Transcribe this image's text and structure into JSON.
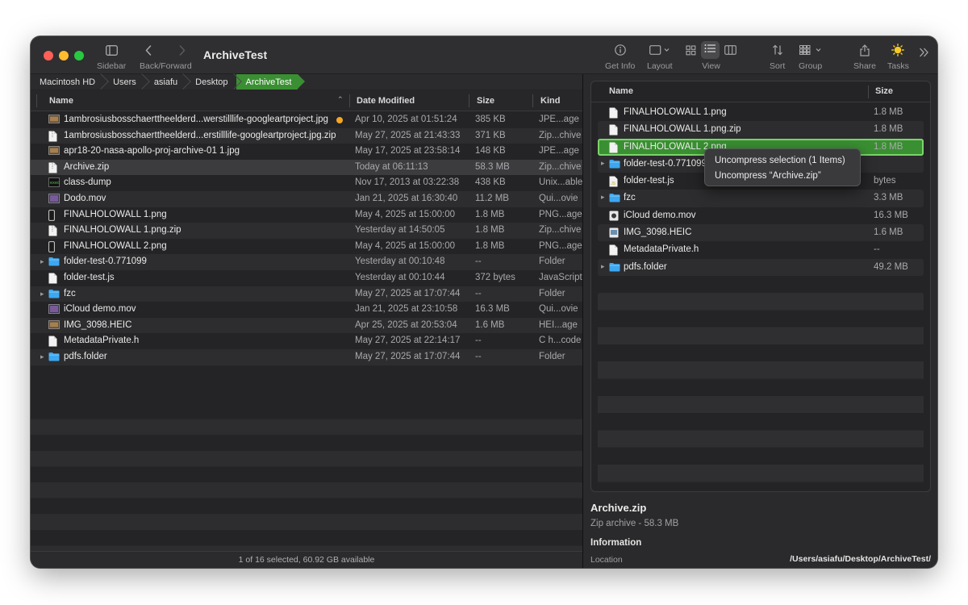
{
  "window": {
    "title": "ArchiveTest"
  },
  "toolbar": {
    "sidebar_label": "Sidebar",
    "backforward_label": "Back/Forward",
    "getinfo_label": "Get Info",
    "layout_label": "Layout",
    "view_label": "View",
    "sort_label": "Sort",
    "group_label": "Group",
    "share_label": "Share",
    "tasks_label": "Tasks"
  },
  "path": [
    "Macintosh HD",
    "Users",
    "asiafu",
    "Desktop",
    "ArchiveTest"
  ],
  "left_columns": {
    "name": "Name",
    "date": "Date Modified",
    "size": "Size",
    "kind": "Kind"
  },
  "files": [
    {
      "name": "1ambrosiusbosschaerttheelderd...werstilllife-googleartproject.jpg",
      "date": "Apr 10, 2025 at 01:51:24",
      "size": "385 KB",
      "kind": "JPE...age",
      "icon": "image-thumb-icon",
      "tag": "#f5a623"
    },
    {
      "name": "1ambrosiusbosschaerttheelderd...erstilllife-googleartproject.jpg.zip",
      "date": "May 27, 2025 at 21:43:33",
      "size": "371 KB",
      "kind": "Zip...chive",
      "icon": "zip-file-icon"
    },
    {
      "name": "apr18-20-nasa-apollo-proj-archive-01 1.jpg",
      "date": "May 17, 2025 at 23:58:14",
      "size": "148 KB",
      "kind": "JPE...age",
      "icon": "image-thumb-icon"
    },
    {
      "name": "Archive.zip",
      "date": "Today at 06:11:13",
      "size": "58.3 MB",
      "kind": "Zip...chive",
      "icon": "zip-file-icon",
      "selected": true
    },
    {
      "name": "class-dump",
      "date": "Nov 17, 2013 at 03:22:38",
      "size": "438 KB",
      "kind": "Unix...able",
      "icon": "terminal-exec-icon"
    },
    {
      "name": "Dodo.mov",
      "date": "Jan 21, 2025 at 16:30:40",
      "size": "11.2 MB",
      "kind": "Qui...ovie",
      "icon": "movie-thumb-icon"
    },
    {
      "name": "FINALHOLOWALL 1.png",
      "date": "May 4, 2025 at 15:00:00",
      "size": "1.8 MB",
      "kind": "PNG...age",
      "icon": "phone-thumb-icon"
    },
    {
      "name": "FINALHOLOWALL 1.png.zip",
      "date": "Yesterday at 14:50:05",
      "size": "1.8 MB",
      "kind": "Zip...chive",
      "icon": "zip-file-icon"
    },
    {
      "name": "FINALHOLOWALL 2.png",
      "date": "May 4, 2025 at 15:00:00",
      "size": "1.8 MB",
      "kind": "PNG...age",
      "icon": "phone-thumb-icon"
    },
    {
      "name": "folder-test-0.771099",
      "date": "Yesterday at 00:10:48",
      "size": "--",
      "kind": "Folder",
      "icon": "folder-icon",
      "expandable": true
    },
    {
      "name": "folder-test.js",
      "date": "Yesterday at 00:10:44",
      "size": "372 bytes",
      "kind": "JavaScript",
      "icon": "document-icon"
    },
    {
      "name": "fzc",
      "date": "May 27, 2025 at 17:07:44",
      "size": "--",
      "kind": "Folder",
      "icon": "folder-icon",
      "expandable": true
    },
    {
      "name": "iCloud demo.mov",
      "date": "Jan 21, 2025 at 23:10:58",
      "size": "16.3 MB",
      "kind": "Qui...ovie",
      "icon": "movie-thumb-icon"
    },
    {
      "name": "IMG_3098.HEIC",
      "date": "Apr 25, 2025 at 20:53:04",
      "size": "1.6 MB",
      "kind": "HEI...age",
      "icon": "image-thumb-icon"
    },
    {
      "name": "MetadataPrivate.h",
      "date": "May 27, 2025 at 22:14:17",
      "size": "--",
      "kind": "C h...code",
      "icon": "document-icon"
    },
    {
      "name": "pdfs.folder",
      "date": "May 27, 2025 at 17:07:44",
      "size": "--",
      "kind": "Folder",
      "icon": "folder-icon",
      "expandable": true
    }
  ],
  "status": "1 of 16 selected, 60.92 GB available",
  "right_columns": {
    "name": "Name",
    "size": "Size"
  },
  "archive_contents": [
    {
      "name": "FINALHOLOWALL 1.png",
      "size": "1.8 MB",
      "icon": "document-icon"
    },
    {
      "name": "FINALHOLOWALL 1.png.zip",
      "size": "1.8 MB",
      "icon": "document-icon"
    },
    {
      "name": "FINALHOLOWALL 2.png",
      "size": "1.8 MB",
      "icon": "document-icon",
      "selected": true
    },
    {
      "name": "folder-test-0.771099",
      "size": "",
      "icon": "folder-icon",
      "expandable": true
    },
    {
      "name": "folder-test.js",
      "size": "bytes",
      "icon": "js-file-icon"
    },
    {
      "name": "fzc",
      "size": "3.3 MB",
      "icon": "folder-icon",
      "expandable": true
    },
    {
      "name": "iCloud demo.mov",
      "size": "16.3 MB",
      "icon": "movie-file-icon"
    },
    {
      "name": "IMG_3098.HEIC",
      "size": "1.6 MB",
      "icon": "image-file-icon"
    },
    {
      "name": "MetadataPrivate.h",
      "size": "--",
      "icon": "document-icon"
    },
    {
      "name": "pdfs.folder",
      "size": "49.2 MB",
      "icon": "folder-icon",
      "expandable": true
    }
  ],
  "context_menu": {
    "items": [
      "Uncompress selection (1 Items)",
      "Uncompress “Archive.zip”"
    ]
  },
  "info": {
    "name": "Archive.zip",
    "kind": "Zip archive - 58.3 MB",
    "section": "Information",
    "location_label": "Location",
    "location_value": "/Users/asiafu/Desktop/ArchiveTest/"
  },
  "colors": {
    "accent": "#3a8f32",
    "tag_orange": "#f5a623",
    "folder_blue": "#3ea7f0"
  }
}
